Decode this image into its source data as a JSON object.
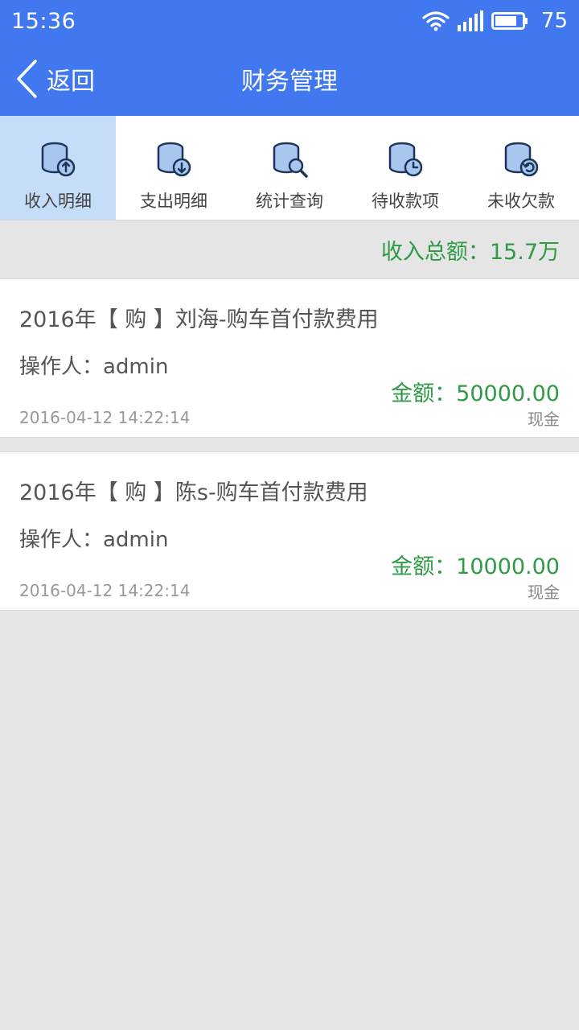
{
  "status_bar": {
    "time": "15:36",
    "battery_percent": "75",
    "icons": [
      "wifi-icon",
      "signal-icon",
      "battery-icon"
    ]
  },
  "nav": {
    "back_label": "返回",
    "title": "财务管理"
  },
  "tabs": [
    {
      "label": "收入明细",
      "icon": "income-coins-icon",
      "active": true
    },
    {
      "label": "支出明细",
      "icon": "expense-coins-icon",
      "active": false
    },
    {
      "label": "统计查询",
      "icon": "stats-search-coins-icon",
      "active": false
    },
    {
      "label": "待收款项",
      "icon": "pending-clock-coins-icon",
      "active": false
    },
    {
      "label": "未收欠款",
      "icon": "overdue-coins-icon",
      "active": false
    }
  ],
  "summary": {
    "text": "收入总额：15.7万"
  },
  "records": [
    {
      "title": "2016年【 购 】刘海-购车首付款费用",
      "operator": "操作人：admin",
      "amount": "金额：50000.00",
      "date": "2016-04-12 14:22:14",
      "method": "现金"
    },
    {
      "title": "2016年【 购 】陈s-购车首付款费用",
      "operator": "操作人：admin",
      "amount": "金额：10000.00",
      "date": "2016-04-12 14:22:14",
      "method": "现金"
    }
  ],
  "colors": {
    "primary": "#4178f0",
    "active_tab": "#c6ddfa",
    "amount_green": "#2f9a45",
    "background": "#e6e5e6"
  }
}
